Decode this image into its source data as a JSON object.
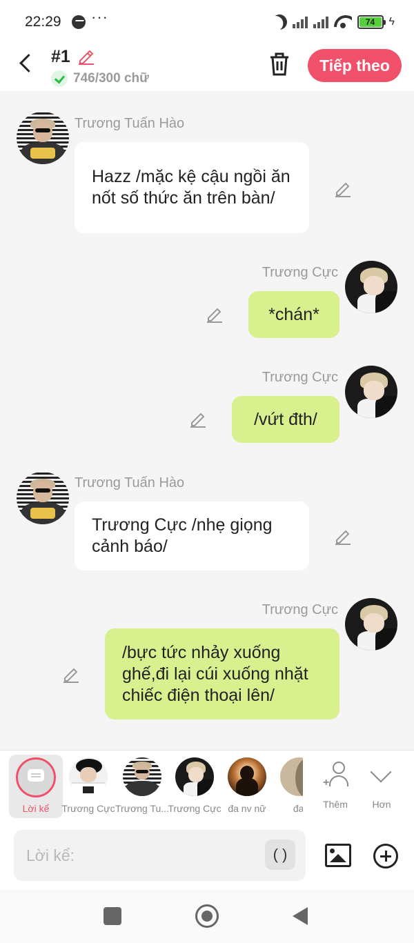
{
  "status_bar": {
    "time": "22:29",
    "dots": "···",
    "battery": "74"
  },
  "header": {
    "title": "#1",
    "word_count": "746/300 chữ",
    "next_label": "Tiếp theo"
  },
  "messages": [
    {
      "sender": "Trương Tuấn Hào",
      "text": "Hazz /mặc kệ cậu ngồi ăn nốt số thức ăn trên bàn/",
      "side": "left"
    },
    {
      "sender": "Trương Cực",
      "text": "*chán*",
      "side": "right"
    },
    {
      "sender": "Trương Cực",
      "text": "/vứt đth/",
      "side": "right"
    },
    {
      "sender": "Trương Tuấn Hào",
      "text": "Trương Cực /nhẹ giọng cảnh báo/",
      "side": "left"
    },
    {
      "sender": "Trương Cực",
      "text": "/bực tức nhảy xuống ghế,đi lại cúi xuống nhặt chiếc điện thoại lên/",
      "side": "right"
    }
  ],
  "characters": [
    {
      "label": "Lời kể",
      "selected": true
    },
    {
      "label": "Trương Cực"
    },
    {
      "label": "Trương Tu..."
    },
    {
      "label": "Trương Cực"
    },
    {
      "label": "đa nv nữ"
    },
    {
      "label": "đa nv"
    }
  ],
  "char_actions": {
    "add_label": "Thêm",
    "more_label": "Hơn"
  },
  "input": {
    "placeholder": "Lời kể:",
    "paren_label": "( )"
  },
  "colors": {
    "accent": "#f0506a",
    "bubble_right": "#d8f08d",
    "bubble_left": "#ffffff"
  }
}
